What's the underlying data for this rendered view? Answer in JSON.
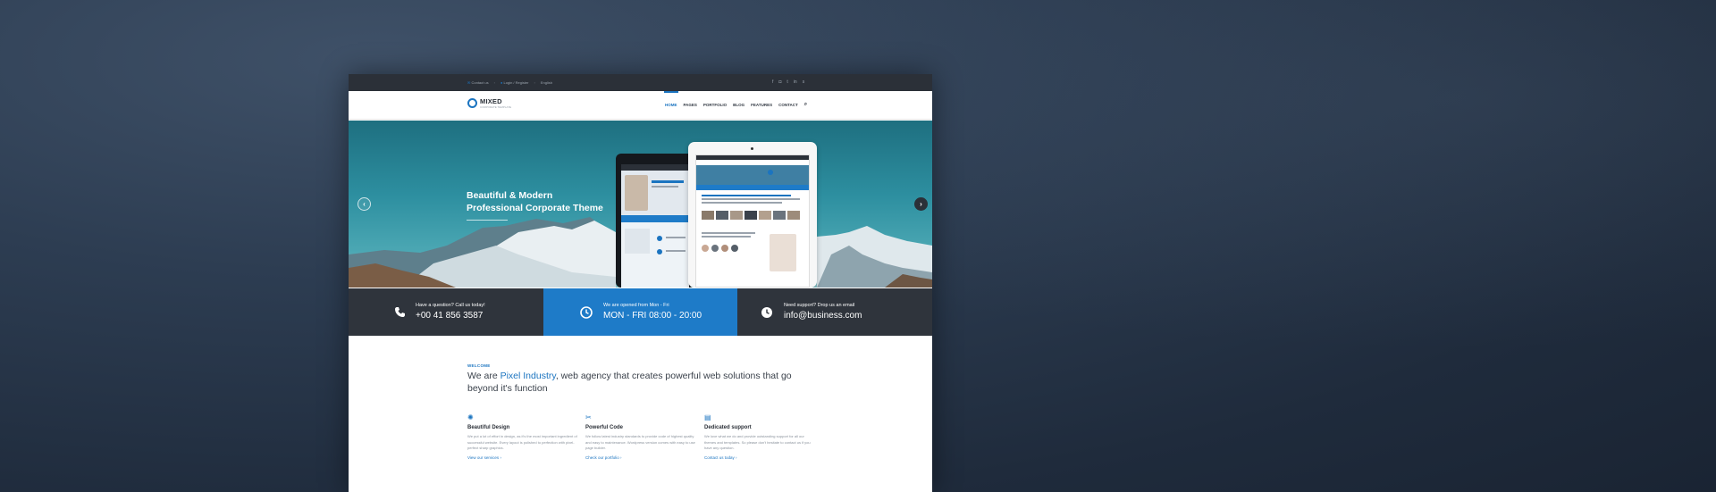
{
  "topbar": {
    "contact": "Contact us",
    "login": "Login / Register",
    "language": "English",
    "social_icons": [
      "facebook-icon",
      "instagram-icon",
      "twitter-icon",
      "linkedin-icon",
      "skype-icon"
    ]
  },
  "header": {
    "logo_name": "MIXED",
    "logo_tagline": "CORPORATE TEMPLATE",
    "nav": [
      "HOME",
      "PAGES",
      "PORTFOLIO",
      "BLOG",
      "FEATURES",
      "CONTACT"
    ]
  },
  "hero": {
    "title_line1": "Beautiful & Modern",
    "title_line2": "Professional Corporate Theme"
  },
  "infobar": [
    {
      "label": "Have a question? Call us today!",
      "value": "+00 41 856 3587",
      "icon": "phone-icon"
    },
    {
      "label": "We are opened from Mon - Fri",
      "value": "MON - FRI 08:00 - 20:00",
      "icon": "clock-icon"
    },
    {
      "label": "Need support? Drop us an email",
      "value": "info@business.com",
      "icon": "clock-icon"
    }
  ],
  "welcome": {
    "tag": "WELCOME",
    "headline_pre": "We are ",
    "headline_highlight": "Pixel Industry",
    "headline_post": ", web agency that creates powerful web solutions that go beyond it's function"
  },
  "features": [
    {
      "title": "Beautiful Design",
      "desc": "We put a lot of effort in design, as it's the most important ingredient of successful website. Every layout is polished to perfection with pixel-perfect sharp graphics.",
      "link": "View our services",
      "icon": "design-icon"
    },
    {
      "title": "Powerful Code",
      "desc": "We follow latest industry standards to provide code of highest quality and easy to maintenance. Wordpress version comes with easy to use page builder.",
      "link": "Check our portfolio",
      "icon": "code-icon"
    },
    {
      "title": "Dedicated support",
      "desc": "We love what we do and provide outstanding support for all our themes and templates. So please don't hesitate to contact us if you have any question.",
      "link": "Contact us today",
      "icon": "support-icon"
    }
  ],
  "colors": {
    "accent": "#1b74c0",
    "dark": "#2f343c",
    "blue_panel": "#1e7bc8"
  }
}
